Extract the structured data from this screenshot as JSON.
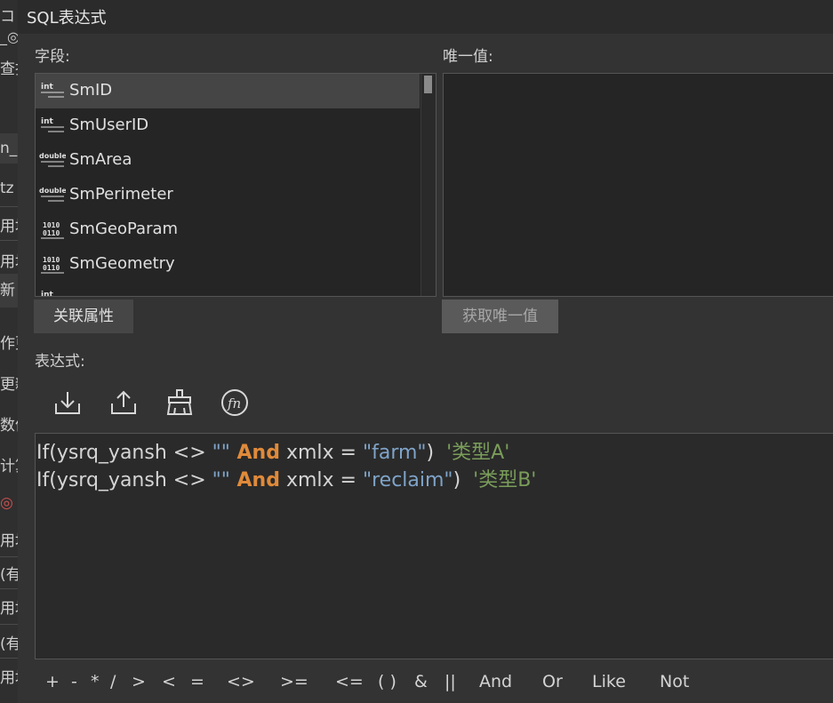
{
  "background_window": {
    "fragments": [
      "コ",
      "_◎",
      "查找",
      "n_l",
      "tz",
      "用地",
      "用地",
      "新",
      "作更",
      "更新",
      "数值",
      "计算",
      "◎ [",
      "用地",
      "(有",
      "用地",
      "(有",
      "用地"
    ]
  },
  "dialog": {
    "title": "SQL表达式",
    "fields_label": "字段:",
    "unique_label": "唯一值:",
    "expression_label": "表达式:",
    "fields": [
      {
        "name": "SmID",
        "type_icon": "int"
      },
      {
        "name": "SmUserID",
        "type_icon": "int"
      },
      {
        "name": "SmArea",
        "type_icon": "double"
      },
      {
        "name": "SmPerimeter",
        "type_icon": "double"
      },
      {
        "name": "SmGeoParam",
        "type_icon": "binary"
      },
      {
        "name": "SmGeometry",
        "type_icon": "binary"
      }
    ],
    "related_button": "关联属性",
    "unique_button": "获取唯一值",
    "toolbar_icons": [
      "import-icon",
      "export-icon",
      "clear-icon",
      "function-icon"
    ],
    "expression_lines": [
      {
        "p1": "If(ysrq_yansh <> ",
        "s1": "\"\"",
        "kw": " And",
        "p2": " xmlx = ",
        "s2": "\"farm\"",
        "p3": ")  ",
        "lit": "'类型A'"
      },
      {
        "p1": "If(ysrq_yansh <> ",
        "s1": "\"\"",
        "kw": " And",
        "p2": " xmlx = ",
        "s2": "\"reclaim\"",
        "p3": ")  ",
        "lit": "'类型B'"
      }
    ],
    "operators": [
      "+",
      "-",
      "*",
      "/",
      ">",
      "<",
      "=",
      "<>",
      ">=",
      "<=",
      "( )",
      "&",
      "||",
      "And",
      "Or",
      "Like",
      "Not"
    ]
  },
  "colors": {
    "background": "#333333",
    "keyword": "#e08a3a",
    "string": "#7fa4c9",
    "literal": "#7a9d5a"
  }
}
